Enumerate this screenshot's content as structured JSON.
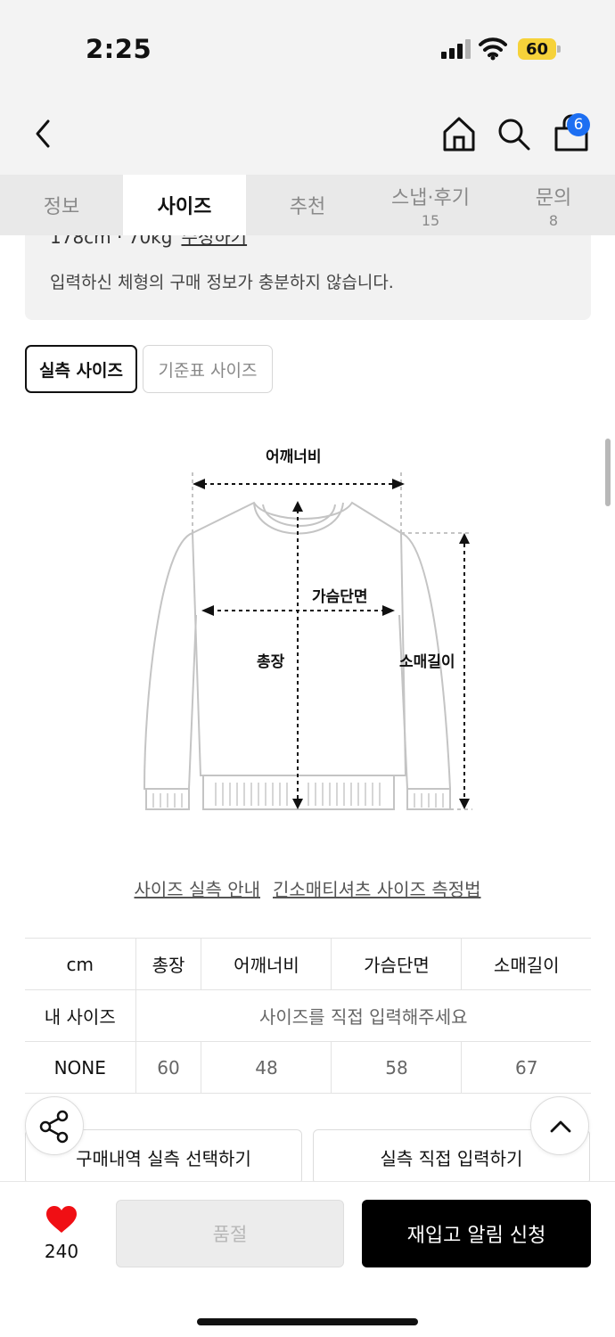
{
  "status_bar": {
    "time": "2:25",
    "battery": "60"
  },
  "header": {
    "back_icon": "chevron-left-icon",
    "home_icon": "home-icon",
    "search_icon": "search-icon",
    "cart_icon": "shopping-bag-icon",
    "cart_count": "6"
  },
  "tabs": [
    {
      "label": "정보",
      "count": ""
    },
    {
      "label": "사이즈",
      "count": "",
      "active": true
    },
    {
      "label": "추천",
      "count": ""
    },
    {
      "label": "스냅·후기",
      "count": "15"
    },
    {
      "label": "문의",
      "count": "8"
    }
  ],
  "info": {
    "cut_text": "178cm · 70kg",
    "cut_link": "수정하기",
    "message": "입력하신 체형의 구매 정보가 충분하지 않습니다."
  },
  "size_toggle": {
    "actual": "실측 사이즈",
    "standard": "기준표 사이즈"
  },
  "diagram": {
    "shoulder": "어깨너비",
    "chest": "가슴단면",
    "length": "총장",
    "sleeve": "소매길이"
  },
  "links": {
    "guide": "사이즈 실측 안내",
    "method": "긴소매티셔츠 사이즈 측정법"
  },
  "table": {
    "headers": [
      "cm",
      "총장",
      "어깨너비",
      "가슴단면",
      "소매길이"
    ],
    "my_size_label": "내 사이즈",
    "my_size_placeholder": "사이즈를 직접 입력해주세요",
    "rows": [
      {
        "name": "NONE",
        "values": [
          "60",
          "48",
          "58",
          "67"
        ]
      }
    ]
  },
  "actions": {
    "select_history": "구매내역 실측 선택하기",
    "input_direct": "실측 직접 입력하기",
    "share_icon": "share-icon",
    "up_icon": "chevron-up-icon"
  },
  "bottom": {
    "like_icon": "heart-icon",
    "like_count": "240",
    "soldout": "품절",
    "restock": "재입고 알림 신청",
    "heart_color": "#f00f14"
  }
}
